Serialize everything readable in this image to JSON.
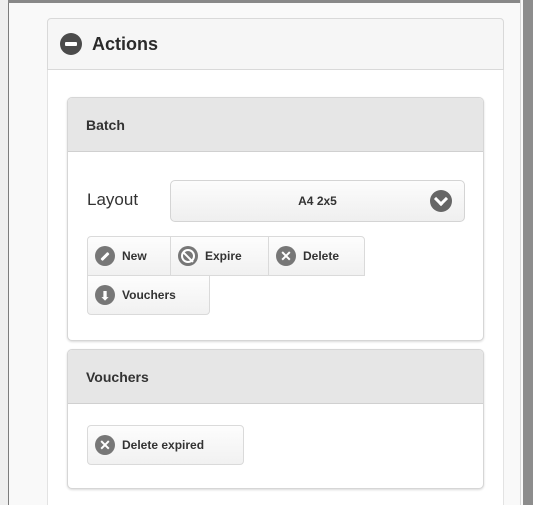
{
  "actions": {
    "title": "Actions"
  },
  "batch": {
    "title": "Batch",
    "layout_label": "Layout",
    "layout_value": "A4 2x5",
    "buttons": {
      "new": "New",
      "expire": "Expire",
      "delete": "Delete",
      "vouchers": "Vouchers"
    }
  },
  "vouchers": {
    "title": "Vouchers",
    "buttons": {
      "delete_expired": "Delete expired"
    }
  },
  "icons": {
    "collapse": "minus-circle-icon",
    "select": "chevron-down-circle-icon",
    "new": "pencil-icon",
    "expire": "ban-icon",
    "delete": "x-circle-icon",
    "vouchers": "arrow-down-circle-icon",
    "delete_expired": "x-circle-icon"
  },
  "colors": {
    "icon_bg": "#777777",
    "panel_header_bg": "#e6e6e6",
    "text": "#333333"
  }
}
